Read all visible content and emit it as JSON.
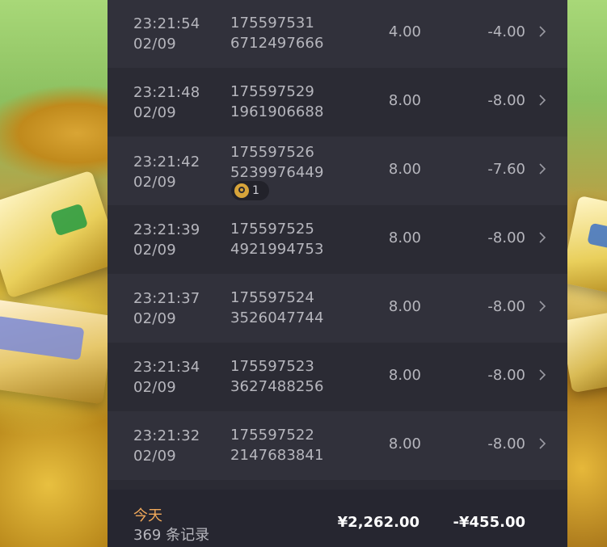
{
  "records": [
    {
      "time": "23:21:54",
      "date": "02/09",
      "order_line1": "175597531",
      "order_line2": "6712497666",
      "bet": "4.00",
      "win": "-4.00"
    },
    {
      "time": "23:21:48",
      "date": "02/09",
      "order_line1": "175597529",
      "order_line2": "1961906688",
      "bet": "8.00",
      "win": "-8.00"
    },
    {
      "time": "23:21:42",
      "date": "02/09",
      "order_line1": "175597526",
      "order_line2": "5239976449",
      "bet": "8.00",
      "win": "-7.60",
      "badge_count": "1"
    },
    {
      "time": "23:21:39",
      "date": "02/09",
      "order_line1": "175597525",
      "order_line2": "4921994753",
      "bet": "8.00",
      "win": "-8.00"
    },
    {
      "time": "23:21:37",
      "date": "02/09",
      "order_line1": "175597524",
      "order_line2": "3526047744",
      "bet": "8.00",
      "win": "-8.00"
    },
    {
      "time": "23:21:34",
      "date": "02/09",
      "order_line1": "175597523",
      "order_line2": "3627488256",
      "bet": "8.00",
      "win": "-8.00"
    },
    {
      "time": "23:21:32",
      "date": "02/09",
      "order_line1": "175597522",
      "order_line2": "2147683841",
      "bet": "8.00",
      "win": "-8.00"
    }
  ],
  "footer": {
    "today_label": "今天",
    "record_count": "369 条记录",
    "total_bet": "¥2,262.00",
    "total_win": "-¥455.00"
  },
  "colors": {
    "panel_bg": "#2b2b34",
    "row_alt_bg": "#31313b",
    "text_muted": "#b6b6bd",
    "today_accent": "#f0a85a"
  },
  "icons": {
    "row_arrow": "chevron-right-icon",
    "badge": "free-spin-icon"
  }
}
